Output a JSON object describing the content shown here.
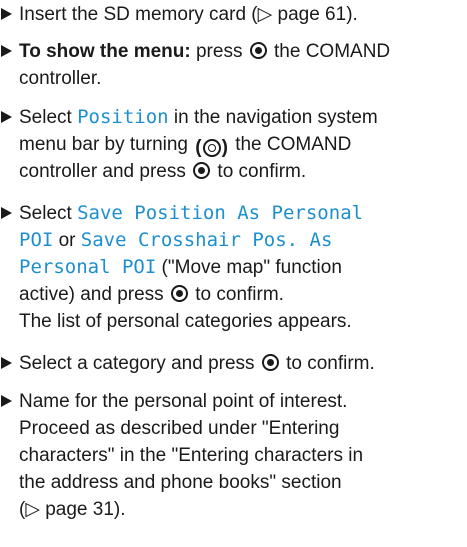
{
  "steps": [
    {
      "lines": [
        {
          "a": "Insert the SD memory card (",
          "ref": "▷ page 61",
          "b": ")."
        }
      ]
    },
    {
      "bold": "To show the menu:",
      "l1": " press ",
      "l1b": " the COMAND",
      "l2": "controller."
    },
    {
      "l1a": "Select ",
      "l1mono": "Position",
      "l1b": " in the navigation system",
      "l2": "menu bar by turning ",
      "l2b": " the COMAND",
      "l3a": "controller and press ",
      "l3b": " to confirm."
    },
    {
      "l1a": "Select ",
      "l1mono": "Save Position As Personal",
      "l2mono": "POI",
      "l2a": " or ",
      "l2mono2": "Save Crosshair Pos. As",
      "l3mono": "Personal POI",
      "l3a": " (\"Move map\" function",
      "l4a": "active) and press ",
      "l4b": " to confirm.",
      "l5": "The list of personal categories appears."
    },
    {
      "l1a": "Select a category and press ",
      "l1b": " to confirm."
    },
    {
      "l1": "Name for the personal point of interest.",
      "l2": "Proceed as described under \"Entering",
      "l3": "characters\" in the \"Entering characters in",
      "l4": "the address and phone books\" section",
      "l5": "(▷ page 31)."
    }
  ],
  "icons": {
    "press": "controller-press-icon",
    "turn": "controller-turn-icon",
    "bullet": "triangle-bullet-icon"
  }
}
